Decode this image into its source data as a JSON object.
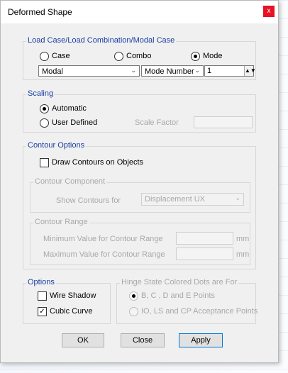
{
  "window": {
    "title": "Deformed Shape",
    "close_glyph": "x"
  },
  "load_case": {
    "group_label": "Load Case/Load Combination/Modal Case",
    "case_label": "Case",
    "combo_label": "Combo",
    "mode_label": "Mode",
    "selected": "Mode",
    "case_select": "Modal",
    "mode_type_select": "Mode Number",
    "mode_number": "1"
  },
  "scaling": {
    "group_label": "Scaling",
    "automatic_label": "Automatic",
    "user_defined_label": "User Defined",
    "selected": "Automatic",
    "scale_factor_label": "Scale Factor",
    "scale_factor_value": ""
  },
  "contour": {
    "group_label": "Contour Options",
    "draw_contours_label": "Draw Contours on Objects",
    "draw_contours_checked": false,
    "component_group_label": "Contour Component",
    "show_for_label": "Show Contours for",
    "show_for_value": "Displacement UX",
    "range_group_label": "Contour Range",
    "min_label": "Minimum Value for Contour Range",
    "max_label": "Maximum Value for Contour Range",
    "min_unit": "mm",
    "max_unit": "mm"
  },
  "options": {
    "group_label": "Options",
    "wire_shadow_label": "Wire Shadow",
    "wire_shadow_checked": false,
    "cubic_curve_label": "Cubic Curve",
    "cubic_curve_checked": true
  },
  "hinge": {
    "group_label": "Hinge State Colored Dots are For",
    "option1_label": "B, C , D and E Points",
    "option2_label": "IO, LS and CP Acceptance Points",
    "selected": "B, C , D and E Points"
  },
  "buttons": {
    "ok": "OK",
    "close": "Close",
    "apply": "Apply"
  },
  "icons": {
    "dropdown": "chevron-down-icon",
    "check": "checkmark-icon",
    "spinner": "spin-arrows-icon"
  }
}
